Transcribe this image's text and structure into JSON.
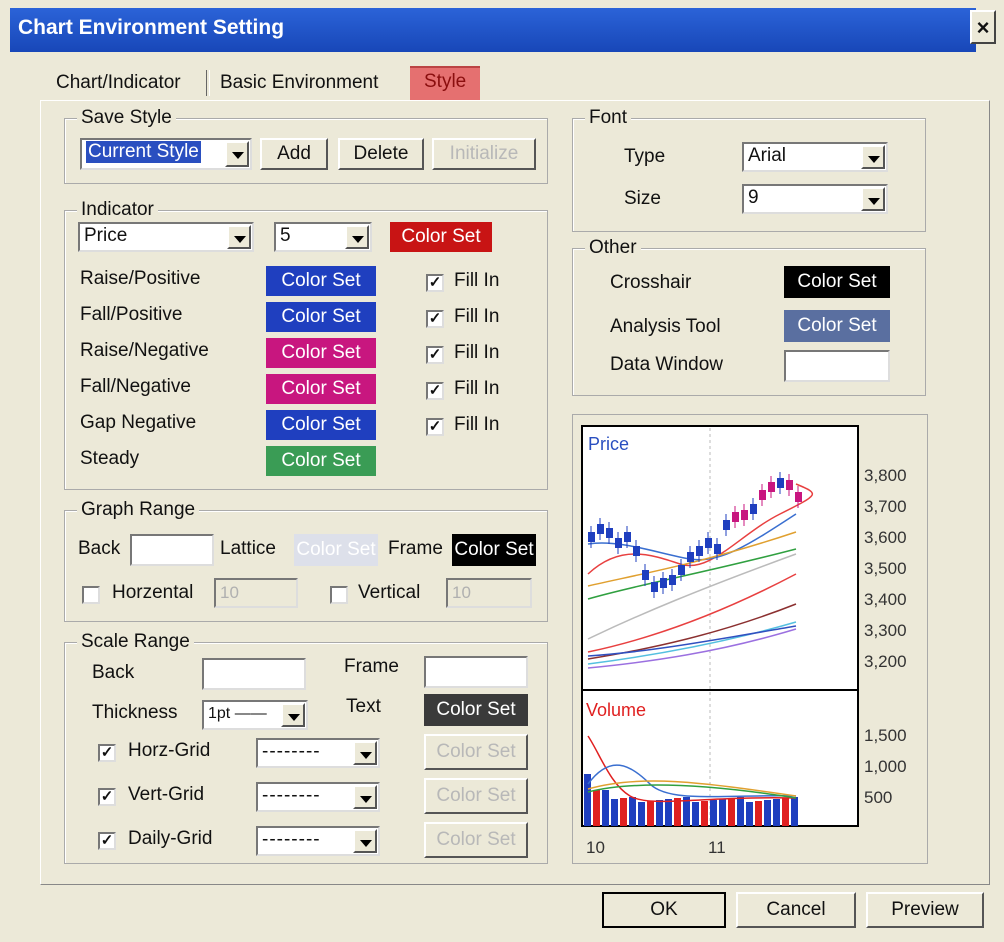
{
  "window": {
    "title": "Chart Environment Setting",
    "close": "×"
  },
  "tabs": [
    {
      "label": "Chart/Indicator"
    },
    {
      "label": "Basic Environment"
    },
    {
      "label": "Style"
    }
  ],
  "save_style": {
    "legend": "Save Style",
    "selected": "Current Style",
    "add": "Add",
    "delete": "Delete",
    "initialize": "Initialize"
  },
  "indicator": {
    "legend": "Indicator",
    "type": "Price",
    "period": "5",
    "colorset_label": "Color Set",
    "fill_label": "Fill In",
    "rows": [
      {
        "label": "Raise/Positive",
        "color": "#1f3fbf",
        "fill": true
      },
      {
        "label": "Fall/Positive",
        "color": "#1f3fbf",
        "fill": true
      },
      {
        "label": "Raise/Negative",
        "color": "#c8167f",
        "fill": true
      },
      {
        "label": "Fall/Negative",
        "color": "#c8167f",
        "fill": true
      },
      {
        "label": "Gap Negative",
        "color": "#1f3fbf",
        "fill": true
      },
      {
        "label": "Steady",
        "color": "#3a9c55"
      }
    ]
  },
  "graph_range": {
    "legend": "Graph Range",
    "back": "Back",
    "lattice": "Lattice",
    "lattice_btn": "Color Set",
    "frame": "Frame",
    "frame_btn": "Color Set",
    "horizontal": "Horzental",
    "horizontal_val": "10",
    "vertical": "Vertical",
    "vertical_val": "10"
  },
  "scale_range": {
    "legend": "Scale Range",
    "back": "Back",
    "frame": "Frame",
    "thickness": "Thickness",
    "thickness_val": "1pt ——",
    "text": "Text",
    "text_btn": "Color Set",
    "grids": [
      {
        "label": "Horz-Grid",
        "style": "--------",
        "btn": "Color Set"
      },
      {
        "label": "Vert-Grid",
        "style": "--------",
        "btn": "Color Set"
      },
      {
        "label": "Daily-Grid",
        "style": "--------",
        "btn": "Color Set"
      }
    ]
  },
  "font": {
    "legend": "Font",
    "type_label": "Type",
    "type_val": "Arial",
    "size_label": "Size",
    "size_val": "9"
  },
  "other": {
    "legend": "Other",
    "crosshair": "Crosshair",
    "crosshair_btn": "Color Set",
    "analysis": "Analysis Tool",
    "analysis_btn": "Color Set",
    "data_window": "Data Window"
  },
  "preview": {
    "price_label": "Price",
    "volume_label": "Volume",
    "price_ticks": [
      "3,800",
      "3,700",
      "3,600",
      "3,500",
      "3,400",
      "3,300",
      "3,200"
    ],
    "volume_ticks": [
      "1,500",
      "1,000",
      "500"
    ],
    "x_ticks": [
      "10",
      "11"
    ]
  },
  "footer": {
    "ok": "OK",
    "cancel": "Cancel",
    "preview": "Preview"
  },
  "colors": {
    "title_bar": "#1f52c8",
    "style_tab": "#e57070",
    "colorset_red": "#c81414",
    "black": "#000000",
    "analysis": "#5a6fa0",
    "text_btn": "#3a3a3a"
  }
}
